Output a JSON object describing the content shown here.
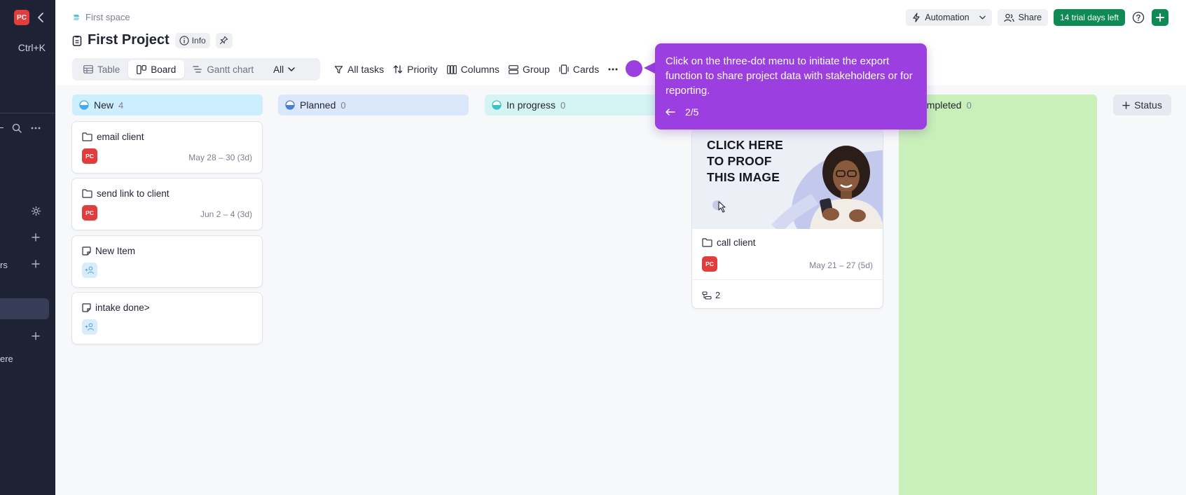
{
  "sidebar": {
    "logo": "PC",
    "shortcut": "Ctrl+K",
    "clipped_text_1": "rs",
    "clipped_text_2": "ere"
  },
  "header": {
    "breadcrumb": "First space",
    "title": "First Project",
    "info_label": "Info",
    "views": [
      "Table",
      "Board",
      "Gantt chart"
    ],
    "view_selector": "All",
    "toolbar": [
      "All tasks",
      "Priority",
      "Columns",
      "Group",
      "Cards"
    ],
    "automation_label": "Automation",
    "share_label": "Share",
    "trial_label": "14 trial days left"
  },
  "board": {
    "columns": [
      {
        "name": "New",
        "count": "4",
        "bg": "#cdeefc",
        "dot": "#4aa7e8"
      },
      {
        "name": "Planned",
        "count": "0",
        "bg": "#dbe8fb",
        "dot": "#4d7cd1"
      },
      {
        "name": "In progress",
        "count": "0",
        "bg": "#d4f4f4",
        "dot": "#3fc0c8"
      },
      {
        "name": "Completed",
        "count": "0",
        "visible_name": "ompleted"
      }
    ],
    "status_button": "Status",
    "new_cards": [
      {
        "title": "email client",
        "avatar": "PC",
        "date": "May 28 – 30 (3d)"
      },
      {
        "title": "send link to client",
        "avatar": "PC",
        "date": "Jun 2 – 4 (3d)"
      },
      {
        "title": "New Item"
      },
      {
        "title": "intake done>"
      }
    ],
    "image_card": {
      "cover_text": "CLICK HERE\nTO PROOF\nTHIS IMAGE",
      "title": "call client",
      "avatar": "PC",
      "date": "May 21 – 27 (5d)",
      "subtasks": "2"
    }
  },
  "tooltip": {
    "text": "Click on the three-dot menu to initiate the export function to share project data with stakeholders or for reporting.",
    "step": "2/5",
    "color": "#9b3fe0"
  }
}
